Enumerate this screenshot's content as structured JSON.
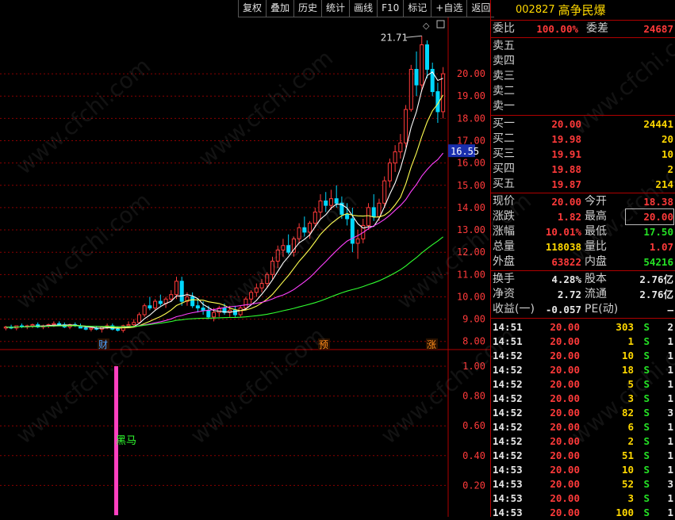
{
  "toolbar": [
    "复权",
    "叠加",
    "历史",
    "统计",
    "画线",
    "F10",
    "标记",
    "+自选",
    "返回"
  ],
  "stock": {
    "code": "002827",
    "name": "高争民爆"
  },
  "price_axis": {
    "labels": [
      "20.00",
      "19.00",
      "18.00",
      "17.00",
      "16.00",
      "15.00",
      "14.00",
      "13.00",
      "12.00",
      "11.00",
      "10.00",
      "9.00",
      "8.00"
    ],
    "current_tag": "16.55",
    "high_mark": "21.71"
  },
  "indicator_axis": {
    "labels": [
      "1.00",
      "0.80",
      "0.60",
      "0.40",
      "0.20"
    ],
    "signal_label": "黑马"
  },
  "event_markers": [
    "财",
    "预",
    "涨"
  ],
  "quote": {
    "wb_label": "委比",
    "wb_value": "100.00%",
    "wc_label": "委差",
    "wc_value": "24687",
    "sells": [
      {
        "label": "卖五"
      },
      {
        "label": "卖四"
      },
      {
        "label": "卖三"
      },
      {
        "label": "卖二"
      },
      {
        "label": "卖一"
      }
    ],
    "buys": [
      {
        "label": "买一",
        "price": "20.00",
        "vol": "24441"
      },
      {
        "label": "买二",
        "price": "19.98",
        "vol": "20"
      },
      {
        "label": "买三",
        "price": "19.91",
        "vol": "10"
      },
      {
        "label": "买四",
        "price": "19.88",
        "vol": "2"
      },
      {
        "label": "买五",
        "price": "19.87",
        "vol": "214"
      }
    ],
    "stats": [
      {
        "l1": "现价",
        "v1": "20.00",
        "c1": "red",
        "l2": "今开",
        "v2": "18.38",
        "c2": "red"
      },
      {
        "l1": "涨跌",
        "v1": "1.82",
        "c1": "red",
        "l2": "最高",
        "v2": "20.00",
        "c2": "red",
        "box2": true
      },
      {
        "l1": "涨幅",
        "v1": "10.01%",
        "c1": "red",
        "l2": "最低",
        "v2": "17.50",
        "c2": "green"
      },
      {
        "l1": "总量",
        "v1": "118038",
        "c1": "yellow",
        "l2": "量比",
        "v2": "1.07",
        "c2": "red"
      },
      {
        "l1": "外盘",
        "v1": "63822",
        "c1": "red",
        "l2": "内盘",
        "v2": "54216",
        "c2": "green"
      }
    ],
    "fin": [
      {
        "l1": "换手",
        "v1": "4.28%",
        "l2": "股本",
        "v2": "2.76亿"
      },
      {
        "l1": "净资",
        "v1": "2.72",
        "l2": "流通",
        "v2": "2.76亿"
      },
      {
        "l1": "收益(一)",
        "v1": "-0.057",
        "l2": "PE(动)",
        "v2": "–"
      }
    ]
  },
  "ticks": [
    {
      "t": "14:51",
      "p": "20.00",
      "v": "303",
      "s": "S",
      "n": "2"
    },
    {
      "t": "14:51",
      "p": "20.00",
      "v": "1",
      "s": "S",
      "n": "1"
    },
    {
      "t": "14:52",
      "p": "20.00",
      "v": "10",
      "s": "S",
      "n": "1"
    },
    {
      "t": "14:52",
      "p": "20.00",
      "v": "18",
      "s": "S",
      "n": "1"
    },
    {
      "t": "14:52",
      "p": "20.00",
      "v": "5",
      "s": "S",
      "n": "1"
    },
    {
      "t": "14:52",
      "p": "20.00",
      "v": "3",
      "s": "S",
      "n": "1"
    },
    {
      "t": "14:52",
      "p": "20.00",
      "v": "82",
      "s": "S",
      "n": "3"
    },
    {
      "t": "14:52",
      "p": "20.00",
      "v": "6",
      "s": "S",
      "n": "1"
    },
    {
      "t": "14:52",
      "p": "20.00",
      "v": "2",
      "s": "S",
      "n": "1"
    },
    {
      "t": "14:52",
      "p": "20.00",
      "v": "51",
      "s": "S",
      "n": "1"
    },
    {
      "t": "14:53",
      "p": "20.00",
      "v": "10",
      "s": "S",
      "n": "1"
    },
    {
      "t": "14:53",
      "p": "20.00",
      "v": "52",
      "s": "S",
      "n": "3"
    },
    {
      "t": "14:53",
      "p": "20.00",
      "v": "3",
      "s": "S",
      "n": "1"
    },
    {
      "t": "14:53",
      "p": "20.00",
      "v": "100",
      "s": "S",
      "n": "1"
    }
  ],
  "watermark": "www.cfchi.com",
  "colors": {
    "up": "#ff3a3a",
    "down": "#00d8ff",
    "ma5": "#ffffff",
    "ma10": "#ffff50",
    "ma20": "#ff40ff",
    "ma60": "#30ff30",
    "grid": "#8a0000",
    "signal": "#ff40c0"
  },
  "chart_data": {
    "type": "candlestick",
    "price_range": [
      7.6,
      22.1
    ],
    "candles": [
      [
        8.6,
        8.7,
        8.5,
        8.65
      ],
      [
        8.65,
        8.75,
        8.55,
        8.6
      ],
      [
        8.6,
        8.7,
        8.5,
        8.7
      ],
      [
        8.7,
        8.8,
        8.6,
        8.65
      ],
      [
        8.65,
        8.75,
        8.55,
        8.7
      ],
      [
        8.7,
        8.8,
        8.6,
        8.75
      ],
      [
        8.75,
        8.85,
        8.6,
        8.65
      ],
      [
        8.65,
        8.75,
        8.55,
        8.7
      ],
      [
        8.7,
        8.8,
        8.6,
        8.75
      ],
      [
        8.75,
        8.9,
        8.65,
        8.8
      ],
      [
        8.8,
        8.9,
        8.7,
        8.75
      ],
      [
        8.75,
        8.85,
        8.6,
        8.65
      ],
      [
        8.65,
        8.8,
        8.55,
        8.75
      ],
      [
        8.75,
        8.85,
        8.65,
        8.7
      ],
      [
        8.7,
        8.8,
        8.6,
        8.6
      ],
      [
        8.6,
        8.7,
        8.5,
        8.55
      ],
      [
        8.55,
        8.7,
        8.45,
        8.6
      ],
      [
        8.6,
        8.7,
        8.5,
        8.55
      ],
      [
        8.55,
        8.7,
        8.4,
        8.65
      ],
      [
        8.65,
        8.8,
        8.55,
        8.7
      ],
      [
        8.7,
        8.8,
        8.5,
        8.55
      ],
      [
        8.55,
        8.65,
        8.45,
        8.5
      ],
      [
        8.5,
        8.75,
        8.4,
        8.7
      ],
      [
        8.7,
        8.9,
        8.6,
        8.75
      ],
      [
        8.75,
        9.0,
        8.65,
        8.85
      ],
      [
        8.85,
        9.3,
        8.8,
        9.2
      ],
      [
        9.2,
        9.7,
        9.1,
        9.6
      ],
      [
        9.6,
        10.0,
        9.4,
        9.5
      ],
      [
        9.5,
        9.9,
        9.4,
        9.8
      ],
      [
        9.8,
        10.1,
        9.6,
        9.7
      ],
      [
        9.7,
        10.0,
        9.5,
        9.9
      ],
      [
        9.9,
        10.3,
        9.8,
        10.1
      ],
      [
        10.1,
        10.9,
        9.9,
        10.7
      ],
      [
        10.7,
        10.9,
        9.6,
        9.8
      ],
      [
        9.8,
        10.2,
        9.6,
        10.0
      ],
      [
        10.0,
        10.2,
        9.5,
        9.6
      ],
      [
        9.6,
        9.9,
        9.3,
        9.5
      ],
      [
        9.5,
        9.8,
        9.2,
        9.4
      ],
      [
        9.4,
        9.6,
        9.0,
        9.1
      ],
      [
        9.1,
        9.5,
        8.9,
        9.3
      ],
      [
        9.3,
        9.6,
        9.1,
        9.5
      ],
      [
        9.5,
        9.7,
        9.2,
        9.3
      ],
      [
        9.3,
        9.6,
        9.1,
        9.4
      ],
      [
        9.4,
        9.6,
        9.1,
        9.2
      ],
      [
        9.2,
        9.6,
        9.1,
        9.5
      ],
      [
        9.5,
        10.0,
        9.4,
        9.9
      ],
      [
        9.9,
        10.3,
        9.7,
        10.2
      ],
      [
        10.2,
        10.6,
        10.0,
        10.4
      ],
      [
        10.4,
        10.8,
        10.2,
        10.6
      ],
      [
        10.6,
        11.1,
        10.4,
        11.0
      ],
      [
        11.0,
        11.8,
        10.8,
        11.6
      ],
      [
        11.6,
        12.3,
        11.3,
        12.1
      ],
      [
        12.1,
        12.6,
        11.8,
        12.3
      ],
      [
        12.3,
        12.8,
        11.9,
        12.0
      ],
      [
        12.0,
        12.7,
        11.8,
        12.6
      ],
      [
        12.6,
        13.3,
        12.4,
        13.1
      ],
      [
        13.1,
        13.6,
        12.7,
        12.9
      ],
      [
        12.9,
        13.4,
        12.6,
        13.3
      ],
      [
        13.3,
        14.0,
        13.1,
        13.8
      ],
      [
        13.8,
        14.6,
        13.5,
        14.3
      ],
      [
        14.3,
        14.7,
        13.8,
        14.1
      ],
      [
        14.1,
        14.8,
        13.9,
        14.4
      ],
      [
        14.4,
        15.0,
        14.0,
        14.2
      ],
      [
        14.2,
        14.5,
        13.5,
        13.7
      ],
      [
        13.7,
        14.2,
        13.2,
        13.5
      ],
      [
        13.5,
        14.0,
        12.0,
        12.4
      ],
      [
        12.4,
        13.0,
        11.7,
        12.6
      ],
      [
        12.6,
        13.5,
        12.4,
        13.2
      ],
      [
        13.2,
        14.2,
        13.0,
        14.0
      ],
      [
        14.0,
        14.6,
        13.4,
        13.6
      ],
      [
        13.6,
        14.4,
        13.4,
        14.2
      ],
      [
        14.2,
        15.4,
        14.0,
        15.2
      ],
      [
        15.2,
        16.2,
        14.9,
        16.0
      ],
      [
        16.0,
        16.8,
        15.6,
        16.5
      ],
      [
        16.5,
        17.3,
        16.2,
        16.9
      ],
      [
        16.9,
        18.6,
        16.7,
        18.4
      ],
      [
        18.4,
        20.4,
        18.3,
        20.2
      ],
      [
        20.2,
        21.0,
        19.0,
        19.5
      ],
      [
        19.5,
        21.7,
        19.2,
        21.3
      ],
      [
        21.3,
        21.5,
        19.8,
        20.2
      ],
      [
        20.2,
        20.5,
        19.0,
        19.2
      ],
      [
        19.2,
        19.6,
        17.8,
        18.3
      ],
      [
        18.3,
        20.3,
        18.0,
        20.0
      ]
    ],
    "signal_value": 1.0
  }
}
